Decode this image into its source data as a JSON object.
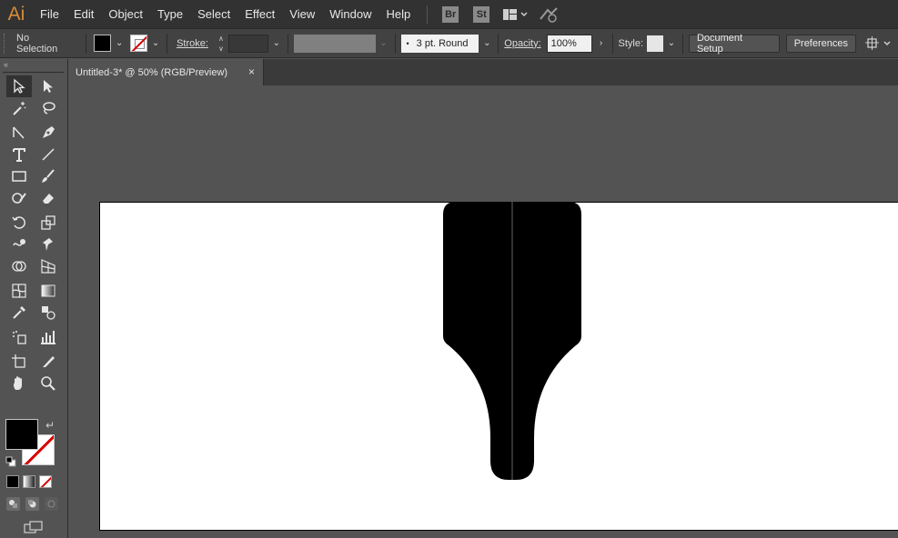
{
  "app": {
    "logo": "Ai"
  },
  "menu": {
    "items": [
      "File",
      "Edit",
      "Object",
      "Type",
      "Select",
      "Effect",
      "View",
      "Window",
      "Help"
    ],
    "bridge_badge": "Br",
    "stock_badge": "St"
  },
  "control_bar": {
    "selection_text": "No Selection",
    "stroke_label": "Stroke:",
    "brush_value": "3 pt. Round",
    "opacity_label": "Opacity:",
    "opacity_value": "100%",
    "style_label": "Style:",
    "document_setup_label": "Document Setup",
    "preferences_label": "Preferences"
  },
  "document": {
    "tab_title": "Untitled-3* @ 50% (RGB/Preview)",
    "tab_close": "×"
  },
  "colors": {
    "fill": "#000000",
    "stroke": "none",
    "accent": "#d98c3a",
    "ui_dark": "#323232",
    "ui_mid": "#535353"
  },
  "tools": [
    [
      "selection-tool-icon",
      "direct-selection-tool-icon"
    ],
    [
      "magic-wand-tool-icon",
      "lasso-tool-icon"
    ],
    [
      "anchor-point-tool-icon",
      "pen-tool-icon"
    ],
    [
      "type-tool-icon",
      "line-segment-tool-icon"
    ],
    [
      "rectangle-tool-icon",
      "paintbrush-tool-icon"
    ],
    [
      "shaper-tool-icon",
      "eraser-tool-icon"
    ],
    [
      "rotate-tool-icon",
      "scale-tool-icon"
    ],
    [
      "warp-tool-icon",
      "puppet-warp-tool-icon"
    ],
    [
      "shape-builder-tool-icon",
      "perspective-grid-tool-icon"
    ],
    [
      "mesh-tool-icon",
      "gradient-tool-icon"
    ],
    [
      "eyedropper-tool-icon",
      "blend-tool-icon"
    ],
    [
      "symbol-sprayer-tool-icon",
      "column-graph-tool-icon"
    ],
    [
      "artboard-tool-icon",
      "slice-tool-icon"
    ],
    [
      "hand-tool-icon",
      "zoom-tool-icon"
    ]
  ]
}
